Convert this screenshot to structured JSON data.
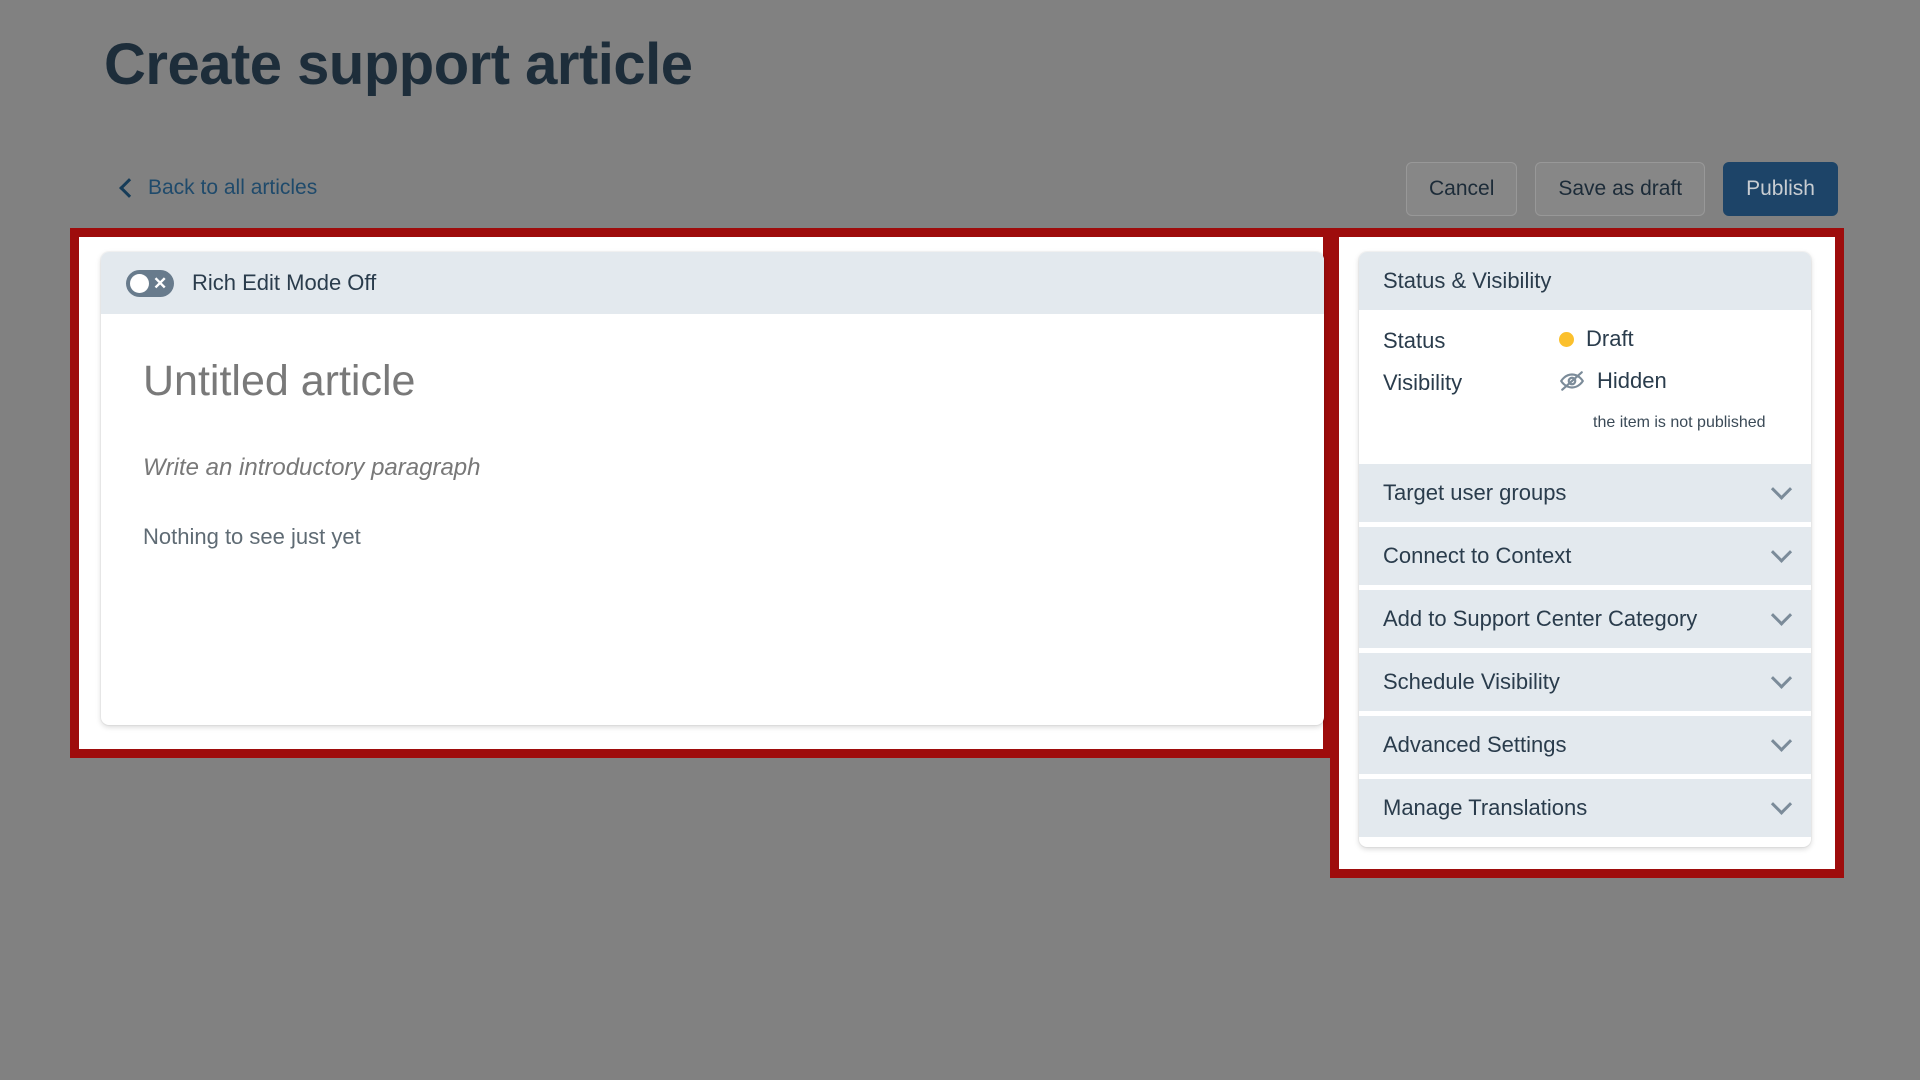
{
  "header": {
    "title": "Create support article",
    "back_link": "Back to all articles",
    "buttons": [
      {
        "label": "Cancel",
        "style": "secondary"
      },
      {
        "label": "Save as draft",
        "style": "secondary"
      },
      {
        "label": "Publish",
        "style": "primary"
      }
    ]
  },
  "editor": {
    "toolbar_label": "Rich Edit Mode Off",
    "toggle_state": "off",
    "title_placeholder": "Untitled article",
    "intro_placeholder": "Write an introductory paragraph",
    "body_placeholder": "Nothing to see just yet"
  },
  "sidebar": {
    "panel_title": "Status & Visibility",
    "status_label": "Status",
    "status_value": "Draft",
    "status_dot_color": "#fbc02d",
    "visibility_label": "Visibility",
    "visibility_value": "Hidden",
    "visibility_note": "the item is not published",
    "sections": [
      {
        "label": "Target user groups"
      },
      {
        "label": "Connect to Context"
      },
      {
        "label": "Add to Support Center Category"
      },
      {
        "label": "Schedule Visibility"
      },
      {
        "label": "Advanced Settings"
      },
      {
        "label": "Manage Translations"
      }
    ]
  },
  "annotations": {
    "highlight_color": "#9e0c0c",
    "boxes": [
      "editor-region",
      "sidebar-region"
    ]
  },
  "theme": {
    "page_background": "#818181",
    "panel_header_bg": "#e3e9ee",
    "text_primary": "#2a3c4c",
    "primary_button": "#1d4468",
    "link_color": "#1f4a6b"
  }
}
